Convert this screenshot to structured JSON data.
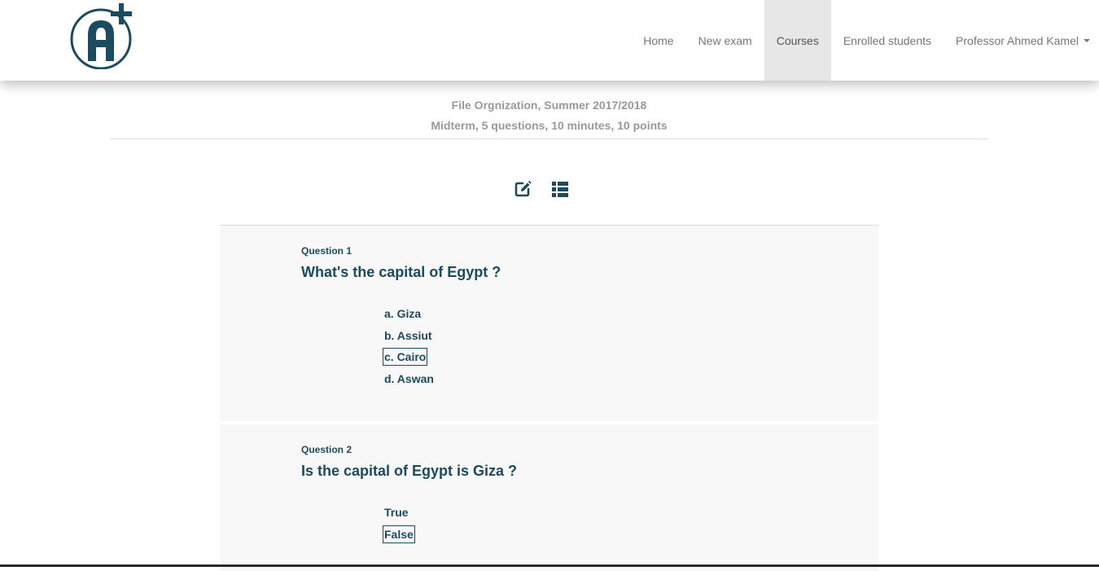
{
  "nav": {
    "logo_text": "A+",
    "items": [
      "Home",
      "New exam",
      "Courses",
      "Enrolled students"
    ],
    "user": "Professor Ahmed Kamel",
    "colors": {
      "brand": "#1b4b5e",
      "active_bg": "#e7e7e7"
    }
  },
  "course": {
    "title": "File Orgnization, Summer 2017/2018",
    "exam_info": "Midterm, 5 questions, 10 minutes, 10 points"
  },
  "tools": {
    "edit_icon": "edit-icon",
    "list_icon": "list-icon"
  },
  "questions": [
    {
      "label": "Question 1",
      "text": "What's the capital of Egypt ?",
      "answers": [
        "a. Giza",
        "b. Assiut",
        "c. Cairo",
        "d. Aswan"
      ],
      "selected": "c. Cairo"
    },
    {
      "label": "Question 2",
      "text": "Is the capital of Egypt is Giza ?",
      "answers": [
        "True",
        "False"
      ],
      "selected": "False"
    }
  ]
}
